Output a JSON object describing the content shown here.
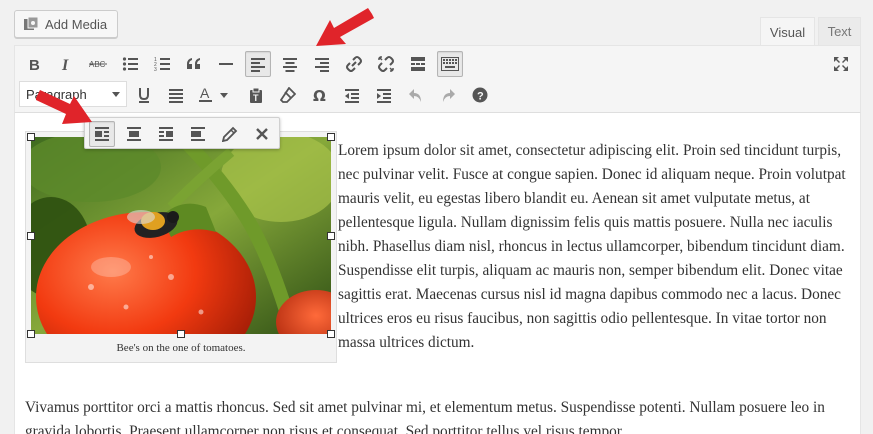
{
  "toolbar": {
    "add_media_label": "Add Media",
    "format_select_value": "Paragraph"
  },
  "tabs": {
    "visual": "Visual",
    "text": "Text"
  },
  "image": {
    "caption": "Bee's on the one of tomatoes."
  },
  "content": {
    "paragraph1": "Lorem ipsum dolor sit amet, consectetur adipiscing elit. Proin sed tincidunt turpis, nec pulvinar velit. Fusce at congue sapien. Donec id aliquam neque. Proin volutpat mauris velit, eu egestas libero blandit eu. Aenean sit amet vulputate metus, at pellentesque ligula. Nullam dignissim felis quis mattis posuere. Nulla nec iaculis nibh. Phasellus diam nisl, rhoncus in lectus ullamcorper, bibendum tincidunt diam. Suspendisse elit turpis, aliquam ac mauris non, semper bibendum elit. Donec vitae sagittis erat. Maecenas cursus nisl id magna dapibus commodo nec a lacus. Donec ultrices eros eu risus faucibus, non sagittis odio pellentesque. In vitae tortor non massa ultrices dictum.",
    "paragraph2": "Vivamus porttitor orci a mattis rhoncus. Sed sit amet pulvinar mi, et elementum metus. Suspendisse potenti. Nullam posuere leo in gravida lobortis. Praesent ullamcorper non risus et consequat. Sed porttitor tellus vel risus tempor"
  },
  "colors": {
    "annotation_arrow": "#e0242a",
    "editor_bg": "#ffffff",
    "toolbar_bg": "#f5f5f5"
  }
}
